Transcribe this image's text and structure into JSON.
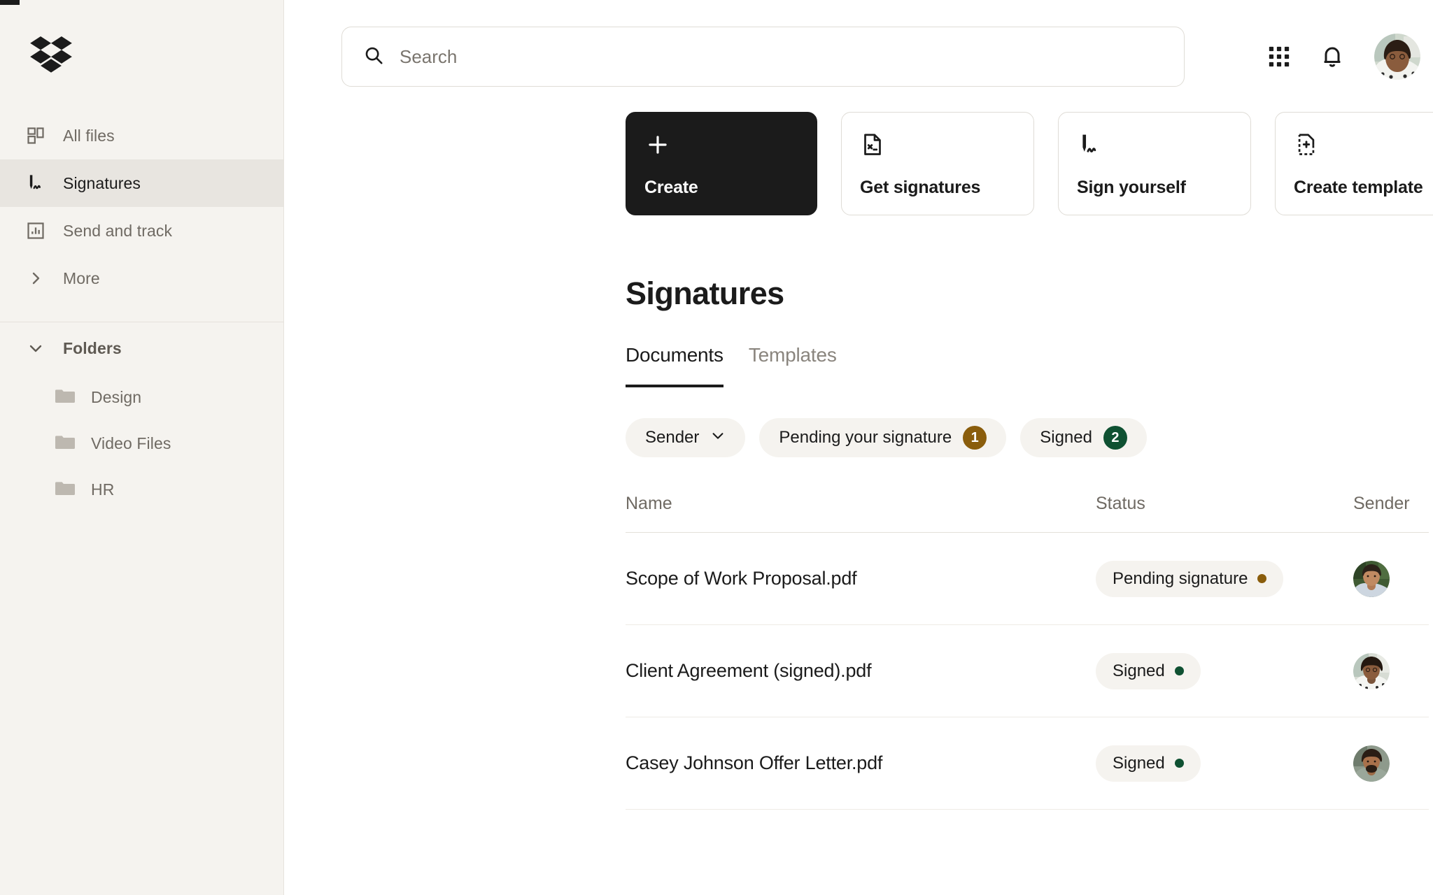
{
  "brand": {
    "logo_icon": "dropbox-logo",
    "accent_dark": "#1b1b1b",
    "sidebar_bg": "#f5f3ef",
    "pending_color": "#8a5d0c",
    "signed_color": "#0f5132"
  },
  "sidebar": {
    "items": [
      {
        "label": "All files",
        "icon": "all-files-icon",
        "active": false
      },
      {
        "label": "Signatures",
        "icon": "signature-pen-icon",
        "active": true
      },
      {
        "label": "Send and track",
        "icon": "send-and-track-chart-icon",
        "active": false
      },
      {
        "label": "More",
        "icon": "chevron-right-icon",
        "active": false
      }
    ],
    "folders_section": {
      "label": "Folders",
      "icon": "chevron-down-icon",
      "items": [
        {
          "label": "Design",
          "icon": "folder-icon"
        },
        {
          "label": "Video Files",
          "icon": "folder-icon"
        },
        {
          "label": "HR",
          "icon": "folder-icon"
        }
      ]
    }
  },
  "topbar": {
    "search": {
      "placeholder": "Search",
      "value": "",
      "icon": "search-icon"
    },
    "grid_icon": "app-grid-icon",
    "bell_icon": "notifications-bell-icon",
    "avatar": "user-avatar"
  },
  "action_cards": [
    {
      "label": "Create",
      "icon": "plus-icon",
      "primary": true
    },
    {
      "label": "Get signatures",
      "icon": "document-signature-icon",
      "primary": false
    },
    {
      "label": "Sign yourself",
      "icon": "pen-signature-icon",
      "primary": false
    },
    {
      "label": "Create template",
      "icon": "document-add-dashed-icon",
      "primary": false
    }
  ],
  "page": {
    "title": "Signatures"
  },
  "tabs": [
    {
      "label": "Documents",
      "active": true
    },
    {
      "label": "Templates",
      "active": false
    }
  ],
  "filters": [
    {
      "label": "Sender",
      "type": "dropdown",
      "icon": "chevron-down-icon"
    },
    {
      "label": "Pending your signature",
      "type": "count",
      "count": "1",
      "color": "#8a5d0c"
    },
    {
      "label": "Signed",
      "type": "count",
      "count": "2",
      "color": "#0f5132"
    }
  ],
  "table": {
    "columns": [
      "Name",
      "Status",
      "Sender"
    ],
    "rows": [
      {
        "name": "Scope of Work Proposal.pdf",
        "status": "Pending signature",
        "status_color": "#8a5d0c",
        "sender_avatar": "sender-avatar-1"
      },
      {
        "name": "Client Agreement (signed).pdf",
        "status": "Signed",
        "status_color": "#0f5132",
        "sender_avatar": "sender-avatar-2"
      },
      {
        "name": "Casey Johnson Offer Letter.pdf",
        "status": "Signed",
        "status_color": "#0f5132",
        "sender_avatar": "sender-avatar-3"
      }
    ]
  }
}
